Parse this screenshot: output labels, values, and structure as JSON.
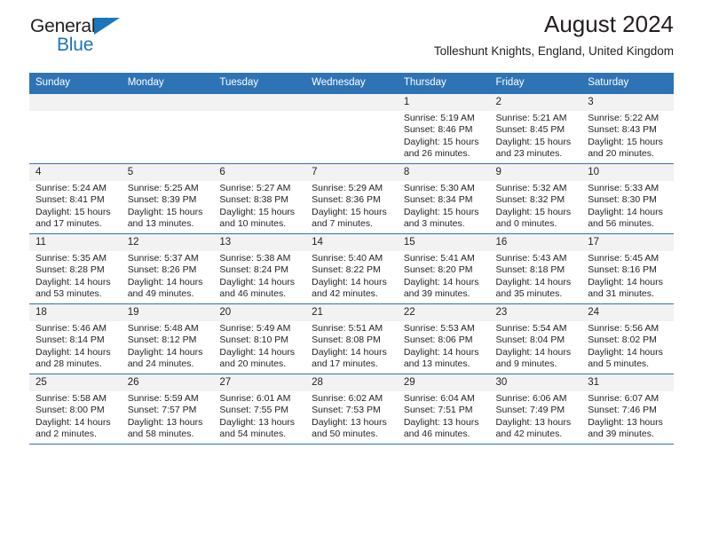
{
  "brand": {
    "name_top": "General",
    "name_bottom": "Blue",
    "triangle_color": "#1b75bb"
  },
  "header": {
    "title": "August 2024",
    "subtitle": "Tolleshunt Knights, England, United Kingdom"
  },
  "theme": {
    "header_bg": "#2e74b5",
    "daynum_bg": "#f2f2f2",
    "text": "#231f20",
    "grid_line": "#2e74b5"
  },
  "weekdays": [
    "Sunday",
    "Monday",
    "Tuesday",
    "Wednesday",
    "Thursday",
    "Friday",
    "Saturday"
  ],
  "weeks": [
    [
      {
        "day": "",
        "lines": []
      },
      {
        "day": "",
        "lines": []
      },
      {
        "day": "",
        "lines": []
      },
      {
        "day": "",
        "lines": []
      },
      {
        "day": "1",
        "lines": [
          "Sunrise: 5:19 AM",
          "Sunset: 8:46 PM",
          "Daylight: 15 hours",
          "and 26 minutes."
        ]
      },
      {
        "day": "2",
        "lines": [
          "Sunrise: 5:21 AM",
          "Sunset: 8:45 PM",
          "Daylight: 15 hours",
          "and 23 minutes."
        ]
      },
      {
        "day": "3",
        "lines": [
          "Sunrise: 5:22 AM",
          "Sunset: 8:43 PM",
          "Daylight: 15 hours",
          "and 20 minutes."
        ]
      }
    ],
    [
      {
        "day": "4",
        "lines": [
          "Sunrise: 5:24 AM",
          "Sunset: 8:41 PM",
          "Daylight: 15 hours",
          "and 17 minutes."
        ]
      },
      {
        "day": "5",
        "lines": [
          "Sunrise: 5:25 AM",
          "Sunset: 8:39 PM",
          "Daylight: 15 hours",
          "and 13 minutes."
        ]
      },
      {
        "day": "6",
        "lines": [
          "Sunrise: 5:27 AM",
          "Sunset: 8:38 PM",
          "Daylight: 15 hours",
          "and 10 minutes."
        ]
      },
      {
        "day": "7",
        "lines": [
          "Sunrise: 5:29 AM",
          "Sunset: 8:36 PM",
          "Daylight: 15 hours",
          "and 7 minutes."
        ]
      },
      {
        "day": "8",
        "lines": [
          "Sunrise: 5:30 AM",
          "Sunset: 8:34 PM",
          "Daylight: 15 hours",
          "and 3 minutes."
        ]
      },
      {
        "day": "9",
        "lines": [
          "Sunrise: 5:32 AM",
          "Sunset: 8:32 PM",
          "Daylight: 15 hours",
          "and 0 minutes."
        ]
      },
      {
        "day": "10",
        "lines": [
          "Sunrise: 5:33 AM",
          "Sunset: 8:30 PM",
          "Daylight: 14 hours",
          "and 56 minutes."
        ]
      }
    ],
    [
      {
        "day": "11",
        "lines": [
          "Sunrise: 5:35 AM",
          "Sunset: 8:28 PM",
          "Daylight: 14 hours",
          "and 53 minutes."
        ]
      },
      {
        "day": "12",
        "lines": [
          "Sunrise: 5:37 AM",
          "Sunset: 8:26 PM",
          "Daylight: 14 hours",
          "and 49 minutes."
        ]
      },
      {
        "day": "13",
        "lines": [
          "Sunrise: 5:38 AM",
          "Sunset: 8:24 PM",
          "Daylight: 14 hours",
          "and 46 minutes."
        ]
      },
      {
        "day": "14",
        "lines": [
          "Sunrise: 5:40 AM",
          "Sunset: 8:22 PM",
          "Daylight: 14 hours",
          "and 42 minutes."
        ]
      },
      {
        "day": "15",
        "lines": [
          "Sunrise: 5:41 AM",
          "Sunset: 8:20 PM",
          "Daylight: 14 hours",
          "and 39 minutes."
        ]
      },
      {
        "day": "16",
        "lines": [
          "Sunrise: 5:43 AM",
          "Sunset: 8:18 PM",
          "Daylight: 14 hours",
          "and 35 minutes."
        ]
      },
      {
        "day": "17",
        "lines": [
          "Sunrise: 5:45 AM",
          "Sunset: 8:16 PM",
          "Daylight: 14 hours",
          "and 31 minutes."
        ]
      }
    ],
    [
      {
        "day": "18",
        "lines": [
          "Sunrise: 5:46 AM",
          "Sunset: 8:14 PM",
          "Daylight: 14 hours",
          "and 28 minutes."
        ]
      },
      {
        "day": "19",
        "lines": [
          "Sunrise: 5:48 AM",
          "Sunset: 8:12 PM",
          "Daylight: 14 hours",
          "and 24 minutes."
        ]
      },
      {
        "day": "20",
        "lines": [
          "Sunrise: 5:49 AM",
          "Sunset: 8:10 PM",
          "Daylight: 14 hours",
          "and 20 minutes."
        ]
      },
      {
        "day": "21",
        "lines": [
          "Sunrise: 5:51 AM",
          "Sunset: 8:08 PM",
          "Daylight: 14 hours",
          "and 17 minutes."
        ]
      },
      {
        "day": "22",
        "lines": [
          "Sunrise: 5:53 AM",
          "Sunset: 8:06 PM",
          "Daylight: 14 hours",
          "and 13 minutes."
        ]
      },
      {
        "day": "23",
        "lines": [
          "Sunrise: 5:54 AM",
          "Sunset: 8:04 PM",
          "Daylight: 14 hours",
          "and 9 minutes."
        ]
      },
      {
        "day": "24",
        "lines": [
          "Sunrise: 5:56 AM",
          "Sunset: 8:02 PM",
          "Daylight: 14 hours",
          "and 5 minutes."
        ]
      }
    ],
    [
      {
        "day": "25",
        "lines": [
          "Sunrise: 5:58 AM",
          "Sunset: 8:00 PM",
          "Daylight: 14 hours",
          "and 2 minutes."
        ]
      },
      {
        "day": "26",
        "lines": [
          "Sunrise: 5:59 AM",
          "Sunset: 7:57 PM",
          "Daylight: 13 hours",
          "and 58 minutes."
        ]
      },
      {
        "day": "27",
        "lines": [
          "Sunrise: 6:01 AM",
          "Sunset: 7:55 PM",
          "Daylight: 13 hours",
          "and 54 minutes."
        ]
      },
      {
        "day": "28",
        "lines": [
          "Sunrise: 6:02 AM",
          "Sunset: 7:53 PM",
          "Daylight: 13 hours",
          "and 50 minutes."
        ]
      },
      {
        "day": "29",
        "lines": [
          "Sunrise: 6:04 AM",
          "Sunset: 7:51 PM",
          "Daylight: 13 hours",
          "and 46 minutes."
        ]
      },
      {
        "day": "30",
        "lines": [
          "Sunrise: 6:06 AM",
          "Sunset: 7:49 PM",
          "Daylight: 13 hours",
          "and 42 minutes."
        ]
      },
      {
        "day": "31",
        "lines": [
          "Sunrise: 6:07 AM",
          "Sunset: 7:46 PM",
          "Daylight: 13 hours",
          "and 39 minutes."
        ]
      }
    ]
  ]
}
